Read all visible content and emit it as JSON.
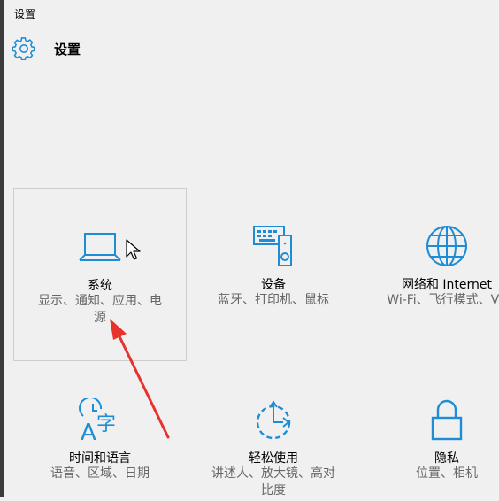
{
  "window": {
    "title": "设置"
  },
  "header": {
    "icon": "gear-icon",
    "title": "设置"
  },
  "tiles": [
    {
      "icon": "laptop-icon",
      "name": "系统",
      "desc_line1": "显示、通知、应用、电",
      "desc_line2": "源",
      "selected": true
    },
    {
      "icon": "devices-icon",
      "name": "设备",
      "desc_line1": "蓝牙、打印机、鼠标"
    },
    {
      "icon": "globe-icon",
      "name": "网络和 Internet",
      "desc_line1": "Wi-Fi、飞行模式、VP"
    },
    {
      "icon": "time-language-icon",
      "name": "时间和语言",
      "desc_line1": "语音、区域、日期",
      "icon_text_a": "A",
      "icon_text_b": "字"
    },
    {
      "icon": "ease-of-access-icon",
      "name": "轻松使用",
      "desc_line1": "讲述人、放大镜、高对",
      "desc_line2": "比度"
    },
    {
      "icon": "privacy-lock-icon",
      "name": "隐私",
      "desc_line1": "位置、相机"
    }
  ],
  "colors": {
    "accent": "#1f8dd6",
    "annotation": "#e8322e",
    "background": "#f0f0f0"
  }
}
